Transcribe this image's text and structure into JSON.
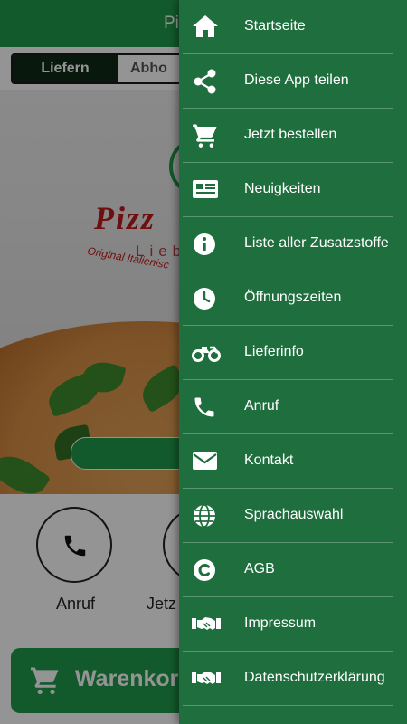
{
  "app": {
    "title_partial": "Pi",
    "segment": {
      "active_label": "Liefern",
      "inactive_label": "Abho"
    },
    "logo": {
      "word": "Pizz",
      "sub": "Lieb",
      "tagline": "Original Italienisc"
    },
    "actions": [
      {
        "label": "Anruf",
        "icon": "phone-icon"
      },
      {
        "label": "Jetz",
        "icon": "order-icon"
      }
    ],
    "cart_label": "Warenkorl"
  },
  "drawer": {
    "items": [
      {
        "label": "Startseite",
        "icon": "home-icon"
      },
      {
        "label": "Diese App teilen",
        "icon": "share-icon"
      },
      {
        "label": "Jetzt bestellen",
        "icon": "cart-icon"
      },
      {
        "label": "Neuigkeiten",
        "icon": "news-icon"
      },
      {
        "label": "Liste aller Zusatzstoffe",
        "icon": "info-icon"
      },
      {
        "label": "Öffnungszeiten",
        "icon": "clock-icon"
      },
      {
        "label": "Lieferinfo",
        "icon": "motorbike-icon"
      },
      {
        "label": "Anruf",
        "icon": "phone-icon"
      },
      {
        "label": "Kontakt",
        "icon": "mail-icon"
      },
      {
        "label": "Sprachauswahl",
        "icon": "globe-icon"
      },
      {
        "label": "AGB",
        "icon": "copyright-icon"
      },
      {
        "label": "Impressum",
        "icon": "handshake-icon"
      },
      {
        "label": "Datenschutzerklärung",
        "icon": "handshake-icon"
      }
    ]
  },
  "colors": {
    "primary": "#1f9a4a",
    "drawer": "#1e6f3d",
    "logo_red": "#c01b1b"
  }
}
